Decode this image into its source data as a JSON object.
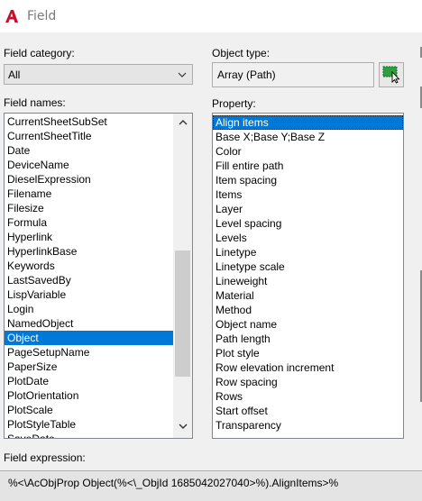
{
  "window": {
    "title": "Field"
  },
  "field_category": {
    "label": "Field category:",
    "value": "All"
  },
  "object_type": {
    "label": "Object type:",
    "value": "Array (Path)"
  },
  "field_names": {
    "label": "Field names:",
    "items": [
      "CurrentSheetSubSet",
      "CurrentSheetTitle",
      "Date",
      "DeviceName",
      "DieselExpression",
      "Filename",
      "Filesize",
      "Formula",
      "Hyperlink",
      "HyperlinkBase",
      "Keywords",
      "LastSavedBy",
      "LispVariable",
      "Login",
      "NamedObject",
      "Object",
      "PageSetupName",
      "PaperSize",
      "PlotDate",
      "PlotOrientation",
      "PlotScale",
      "PlotStyleTable",
      "SaveDate"
    ],
    "selected": "Object"
  },
  "property": {
    "label": "Property:",
    "items": [
      "Align items",
      "Base X;Base Y;Base Z",
      "Color",
      "Fill entire path",
      "Item spacing",
      "Items",
      "Layer",
      "Level spacing",
      "Levels",
      "Linetype",
      "Linetype scale",
      "Lineweight",
      "Material",
      "Method",
      "Object name",
      "Path length",
      "Plot style",
      "Row elevation increment",
      "Row spacing",
      "Rows",
      "Start offset",
      "Transparency"
    ],
    "selected": "Align items"
  },
  "field_expression": {
    "label": "Field expression:",
    "value": "%<\\AcObjProp Object(%<\\_ObjId 1685042027040>%).AlignItems>%"
  },
  "icons": {
    "app": "autocad-logo-icon",
    "dropdown": "chevron-down-icon",
    "pick": "select-objects-icon",
    "scroll_up": "chevron-up-icon",
    "scroll_down": "chevron-down-icon"
  },
  "colors": {
    "selection": "#0078d7",
    "app_red": "#c8102e",
    "pick_green": "#2e9e3e"
  }
}
